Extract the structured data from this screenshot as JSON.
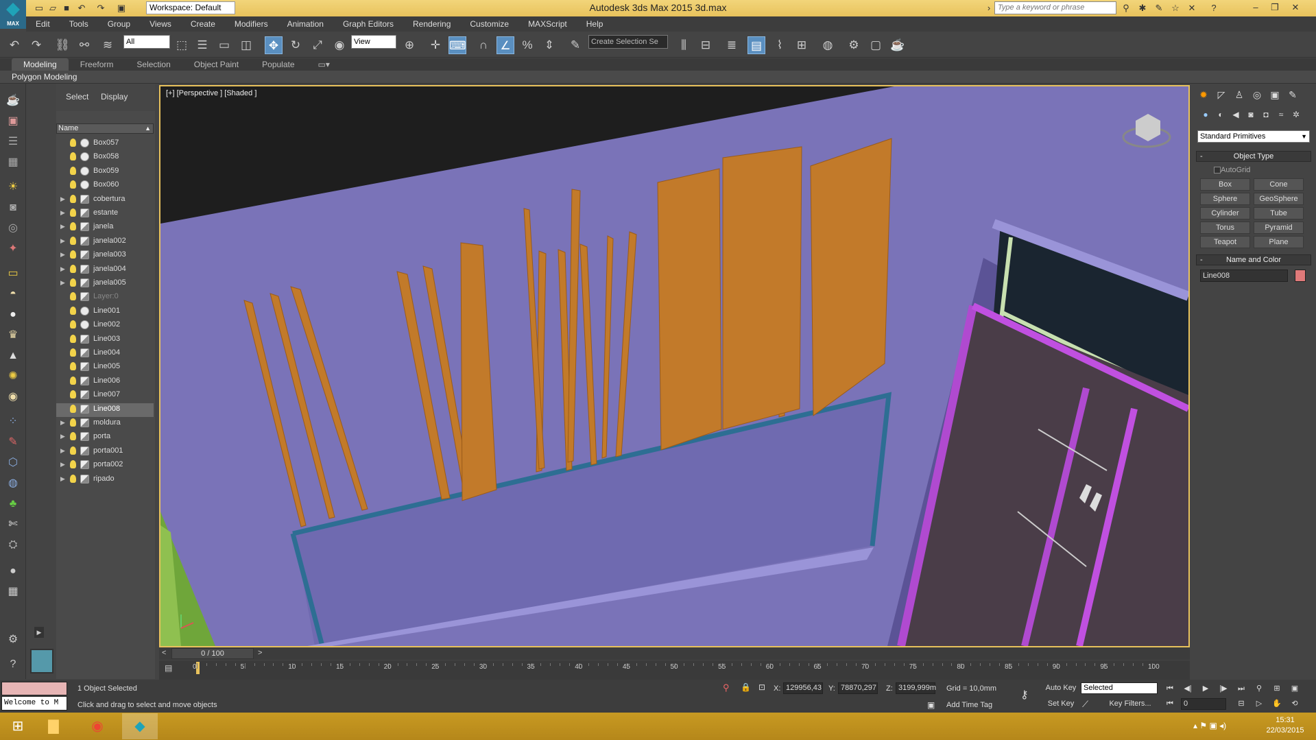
{
  "app": {
    "title": "Autodesk 3ds Max  2015     3d.max",
    "logo_label": "MAX",
    "workspace": "Workspace: Default",
    "search_placeholder": "Type a keyword or phrase"
  },
  "menu": [
    "Edit",
    "Tools",
    "Group",
    "Views",
    "Create",
    "Modifiers",
    "Animation",
    "Graph Editors",
    "Rendering",
    "Customize",
    "MAXScript",
    "Help"
  ],
  "toolbar": {
    "filter_value": "All",
    "refcoord_value": "View",
    "selection_set_placeholder": "Create Selection Se"
  },
  "ribbon": {
    "tabs": [
      "Modeling",
      "Freeform",
      "Selection",
      "Object Paint",
      "Populate"
    ],
    "active_tab": "Modeling",
    "panel_label": "Polygon Modeling"
  },
  "explorer": {
    "tabs": [
      "Select",
      "Display"
    ],
    "column_header": "Name",
    "rows": [
      {
        "name": "Box057",
        "type": "obj",
        "expand": false
      },
      {
        "name": "Box058",
        "type": "obj",
        "expand": false
      },
      {
        "name": "Box059",
        "type": "obj",
        "expand": false
      },
      {
        "name": "Box060",
        "type": "obj",
        "expand": false
      },
      {
        "name": "cobertura",
        "type": "grp",
        "expand": true
      },
      {
        "name": "estante",
        "type": "grp",
        "expand": true
      },
      {
        "name": "janela",
        "type": "grp",
        "expand": true
      },
      {
        "name": "janela002",
        "type": "grp",
        "expand": true
      },
      {
        "name": "janela003",
        "type": "grp",
        "expand": true
      },
      {
        "name": "janela004",
        "type": "grp",
        "expand": true
      },
      {
        "name": "janela005",
        "type": "grp",
        "expand": true
      },
      {
        "name": "Layer:0",
        "type": "grp",
        "expand": false,
        "dim": true
      },
      {
        "name": "Line001",
        "type": "obj",
        "expand": false
      },
      {
        "name": "Line002",
        "type": "obj",
        "expand": false
      },
      {
        "name": "Line003",
        "type": "grp",
        "expand": false
      },
      {
        "name": "Line004",
        "type": "grp",
        "expand": false
      },
      {
        "name": "Line005",
        "type": "grp",
        "expand": false
      },
      {
        "name": "Line006",
        "type": "grp",
        "expand": false
      },
      {
        "name": "Line007",
        "type": "grp",
        "expand": false
      },
      {
        "name": "Line008",
        "type": "grp",
        "expand": false,
        "selected": true
      },
      {
        "name": "moldura",
        "type": "grp",
        "expand": true
      },
      {
        "name": "porta",
        "type": "grp",
        "expand": true
      },
      {
        "name": "porta001",
        "type": "grp",
        "expand": true
      },
      {
        "name": "porta002",
        "type": "grp",
        "expand": true
      },
      {
        "name": "ripado",
        "type": "grp",
        "expand": true
      }
    ]
  },
  "viewport": {
    "label": "[+] [Perspective ] [Shaded ]"
  },
  "command_panel": {
    "dropdown": "Standard Primitives",
    "object_type_header": "Object Type",
    "autogrid_label": "AutoGrid",
    "primitives": [
      "Box",
      "Cone",
      "Sphere",
      "GeoSphere",
      "Cylinder",
      "Tube",
      "Torus",
      "Pyramid",
      "Teapot",
      "Plane"
    ],
    "name_color_header": "Name and Color",
    "object_name": "Line008",
    "object_color": "#e07a7a"
  },
  "timeline": {
    "slider_label": "0 / 100",
    "ticks": [
      "0",
      "5",
      "10",
      "15",
      "20",
      "25",
      "30",
      "35",
      "40",
      "45",
      "50",
      "55",
      "60",
      "65",
      "70",
      "75",
      "80",
      "85",
      "90",
      "95",
      "100"
    ]
  },
  "status": {
    "selection": "1 Object Selected",
    "prompt": "Click and drag to select and move objects",
    "welcome": "Welcome to M",
    "x_label": "X:",
    "x_value": "129956,43",
    "y_label": "Y:",
    "y_value": "78870,297",
    "z_label": "Z:",
    "z_value": "3199,999m",
    "grid": "Grid = 10,0mm",
    "add_time_tag": "Add Time Tag",
    "auto_key": "Auto Key",
    "set_key": "Set Key",
    "key_mode": "Selected",
    "key_filters": "Key Filters...",
    "frame": "0"
  },
  "taskbar": {
    "time": "15:31",
    "date": "22/03/2015"
  },
  "colors": {
    "wall": "#7a73b8",
    "curtain": "#c27a2a",
    "accent": "#e8c25c"
  }
}
